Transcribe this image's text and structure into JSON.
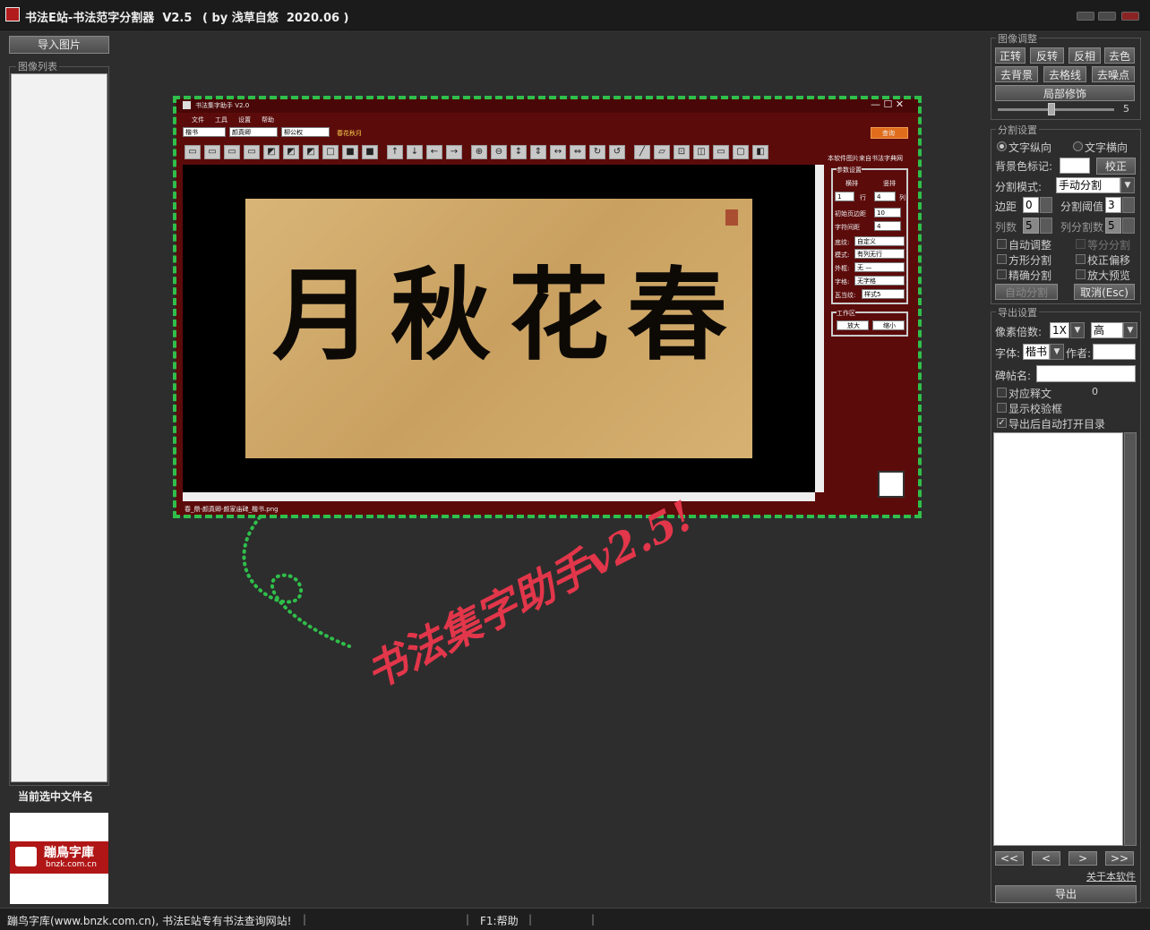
{
  "window": {
    "title": "书法E站-书法范字分割器  V2.5",
    "subtitle": "( by 浅草自悠  2020.06 )"
  },
  "left": {
    "import_button": "导入图片",
    "image_list_title": "图像列表",
    "selected_file_label": "当前选中文件名",
    "logo_text": "蹦鳥字庫",
    "logo_url": "bnzk.com.cn"
  },
  "canvas": {
    "embedded_window_title": "书法集字助手  V2.0",
    "embedded_menu": [
      "文件",
      "工具",
      "设置",
      "帮助"
    ],
    "embedded_selects": [
      "楷书",
      "颜真卿",
      "柳公权"
    ],
    "embedded_query_text": "春花秋月",
    "embedded_query_button": "查询",
    "embedded_note": "本软件图片来自书法字典网",
    "embedded_params_title": "参数设置",
    "embedded_radio_a": "横排",
    "embedded_radio_b": "竖排",
    "embedded_row_label": "行",
    "embedded_col_label": "列",
    "embedded_row_val": "1",
    "embedded_col_val": "4",
    "embedded_margin_label": "初始页边距",
    "embedded_margin_val": "10",
    "embedded_spacing_label": "字符间距",
    "embedded_spacing_val": "4",
    "embedded_rows": [
      {
        "label": "底纹:",
        "value": "自定义"
      },
      {
        "label": "模式:",
        "value": "有列无行"
      },
      {
        "label": "外框:",
        "value": "无  —"
      },
      {
        "label": "字格:",
        "value": "无字格"
      },
      {
        "label": "瓦当纹:",
        "value": "样式5"
      }
    ],
    "embedded_work_title": "工作区",
    "embedded_zoom_in": "放大",
    "embedded_zoom_out": "缩小",
    "embedded_status": "春_鼎-颜真卿-颜家庙碑_楷书.png",
    "calligraphy": "月秋花春",
    "banner": "书法集字助手v2.5!"
  },
  "right": {
    "image_adjust_title": "图像调整",
    "btns_row1": [
      "正转",
      "反转",
      "反相",
      "去色"
    ],
    "btns_row2": [
      "去背景",
      "去格线",
      "去噪点"
    ],
    "local_fix": "局部修饰",
    "slider_value": "5",
    "split_title": "分割设置",
    "radio_vertical": "文字纵向",
    "radio_horizontal": "文字横向",
    "bg_color_label": "背景色标记:",
    "correct_button": "校正",
    "mode_label": "分割模式:",
    "mode_value": "手动分割",
    "margin_label": "边距",
    "margin_value": "0",
    "threshold_label": "分割阈值",
    "threshold_value": "3",
    "cols_label": "列数",
    "cols_value": "5",
    "col_split_label": "列分割数",
    "col_split_value": "5",
    "checks": [
      {
        "label": "自动调整",
        "checked": false
      },
      {
        "label": "等分分割",
        "checked": false,
        "disabled": true
      },
      {
        "label": "方形分割",
        "checked": false
      },
      {
        "label": "校正偏移",
        "checked": false
      },
      {
        "label": "精确分割",
        "checked": false
      },
      {
        "label": "放大预览",
        "checked": false
      }
    ],
    "auto_split_button": "自动分割",
    "cancel_button": "取消(Esc)",
    "export_title": "导出设置",
    "pixel_label": "像素倍数:",
    "pixel_value": "1X",
    "quality_value": "高",
    "font_label": "字体:",
    "font_value": "楷书",
    "author_label": "作者:",
    "stele_label": "碑帖名:",
    "checks2": [
      {
        "label": "对应释文",
        "checked": false
      },
      {
        "label": "显示校验框",
        "checked": false
      },
      {
        "label": "导出后自动打开目录",
        "checked": true
      }
    ],
    "annotation_count": "0",
    "nav": [
      "<<",
      "<",
      ">",
      ">>"
    ],
    "about_link": "关于本软件",
    "export_button": "导出"
  },
  "status": {
    "left": "蹦鸟字库(www.bnzk.com.cn), 书法E站专有书法查询网站!",
    "help": "F1:帮助"
  },
  "colors": {
    "accent_green": "#2fbf4a",
    "banner_red": "#e2364a",
    "embedded_red": "#5c0b0b",
    "app_bg": "#2d2d2d"
  }
}
